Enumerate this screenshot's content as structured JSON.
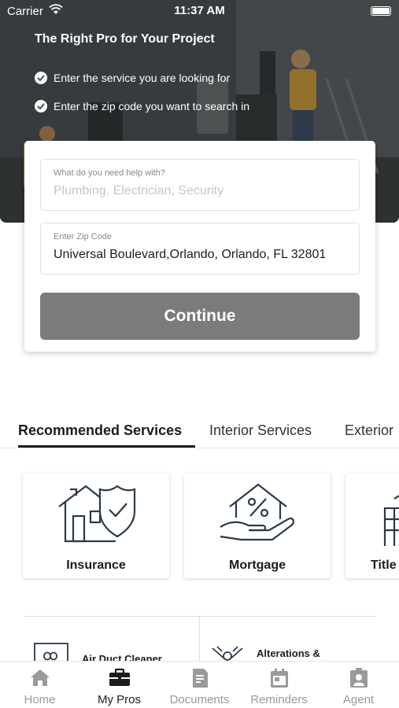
{
  "status_bar": {
    "carrier": "Carrier",
    "time": "11:37 AM"
  },
  "hero": {
    "title": "The Right Pro for Your Project",
    "steps": [
      "Enter the service you are looking for",
      "Enter the zip code you want to search in"
    ]
  },
  "search": {
    "service_label": "What do you need help with?",
    "service_placeholder": "Plumbing, Electrician, Security",
    "service_value": "",
    "zip_label": "Enter Zip Code",
    "zip_value": "Universal Boulevard,Orlando, Orlando, FL 32801",
    "continue_label": "Continue"
  },
  "service_tabs": [
    {
      "label": "Recommended Services",
      "active": true
    },
    {
      "label": "Interior Services",
      "active": false
    },
    {
      "label": "Exterior",
      "active": false
    }
  ],
  "services": [
    {
      "label": "Insurance",
      "icon": "house-shield-icon"
    },
    {
      "label": "Mortgage",
      "icon": "hand-house-percent-icon"
    },
    {
      "label": "Title",
      "icon": "document-icon"
    }
  ],
  "list_items": [
    {
      "label": "Air Duct Cleaner",
      "icon": "air-duct-icon"
    },
    {
      "label": "Alterations &",
      "icon": "hammer-wrench-icon"
    }
  ],
  "tab_bar": [
    {
      "label": "Home",
      "icon": "home-icon",
      "active": false
    },
    {
      "label": "My Pros",
      "icon": "briefcase-icon",
      "active": true
    },
    {
      "label": "Documents",
      "icon": "document-icon",
      "active": false
    },
    {
      "label": "Reminders",
      "icon": "calendar-icon",
      "active": false
    },
    {
      "label": "Agent",
      "icon": "agent-badge-icon",
      "active": false
    }
  ],
  "colors": {
    "button_disabled": "#7b7b7b",
    "tab_active": "#1c1c1c",
    "tab_inactive": "#9a9a9a"
  }
}
